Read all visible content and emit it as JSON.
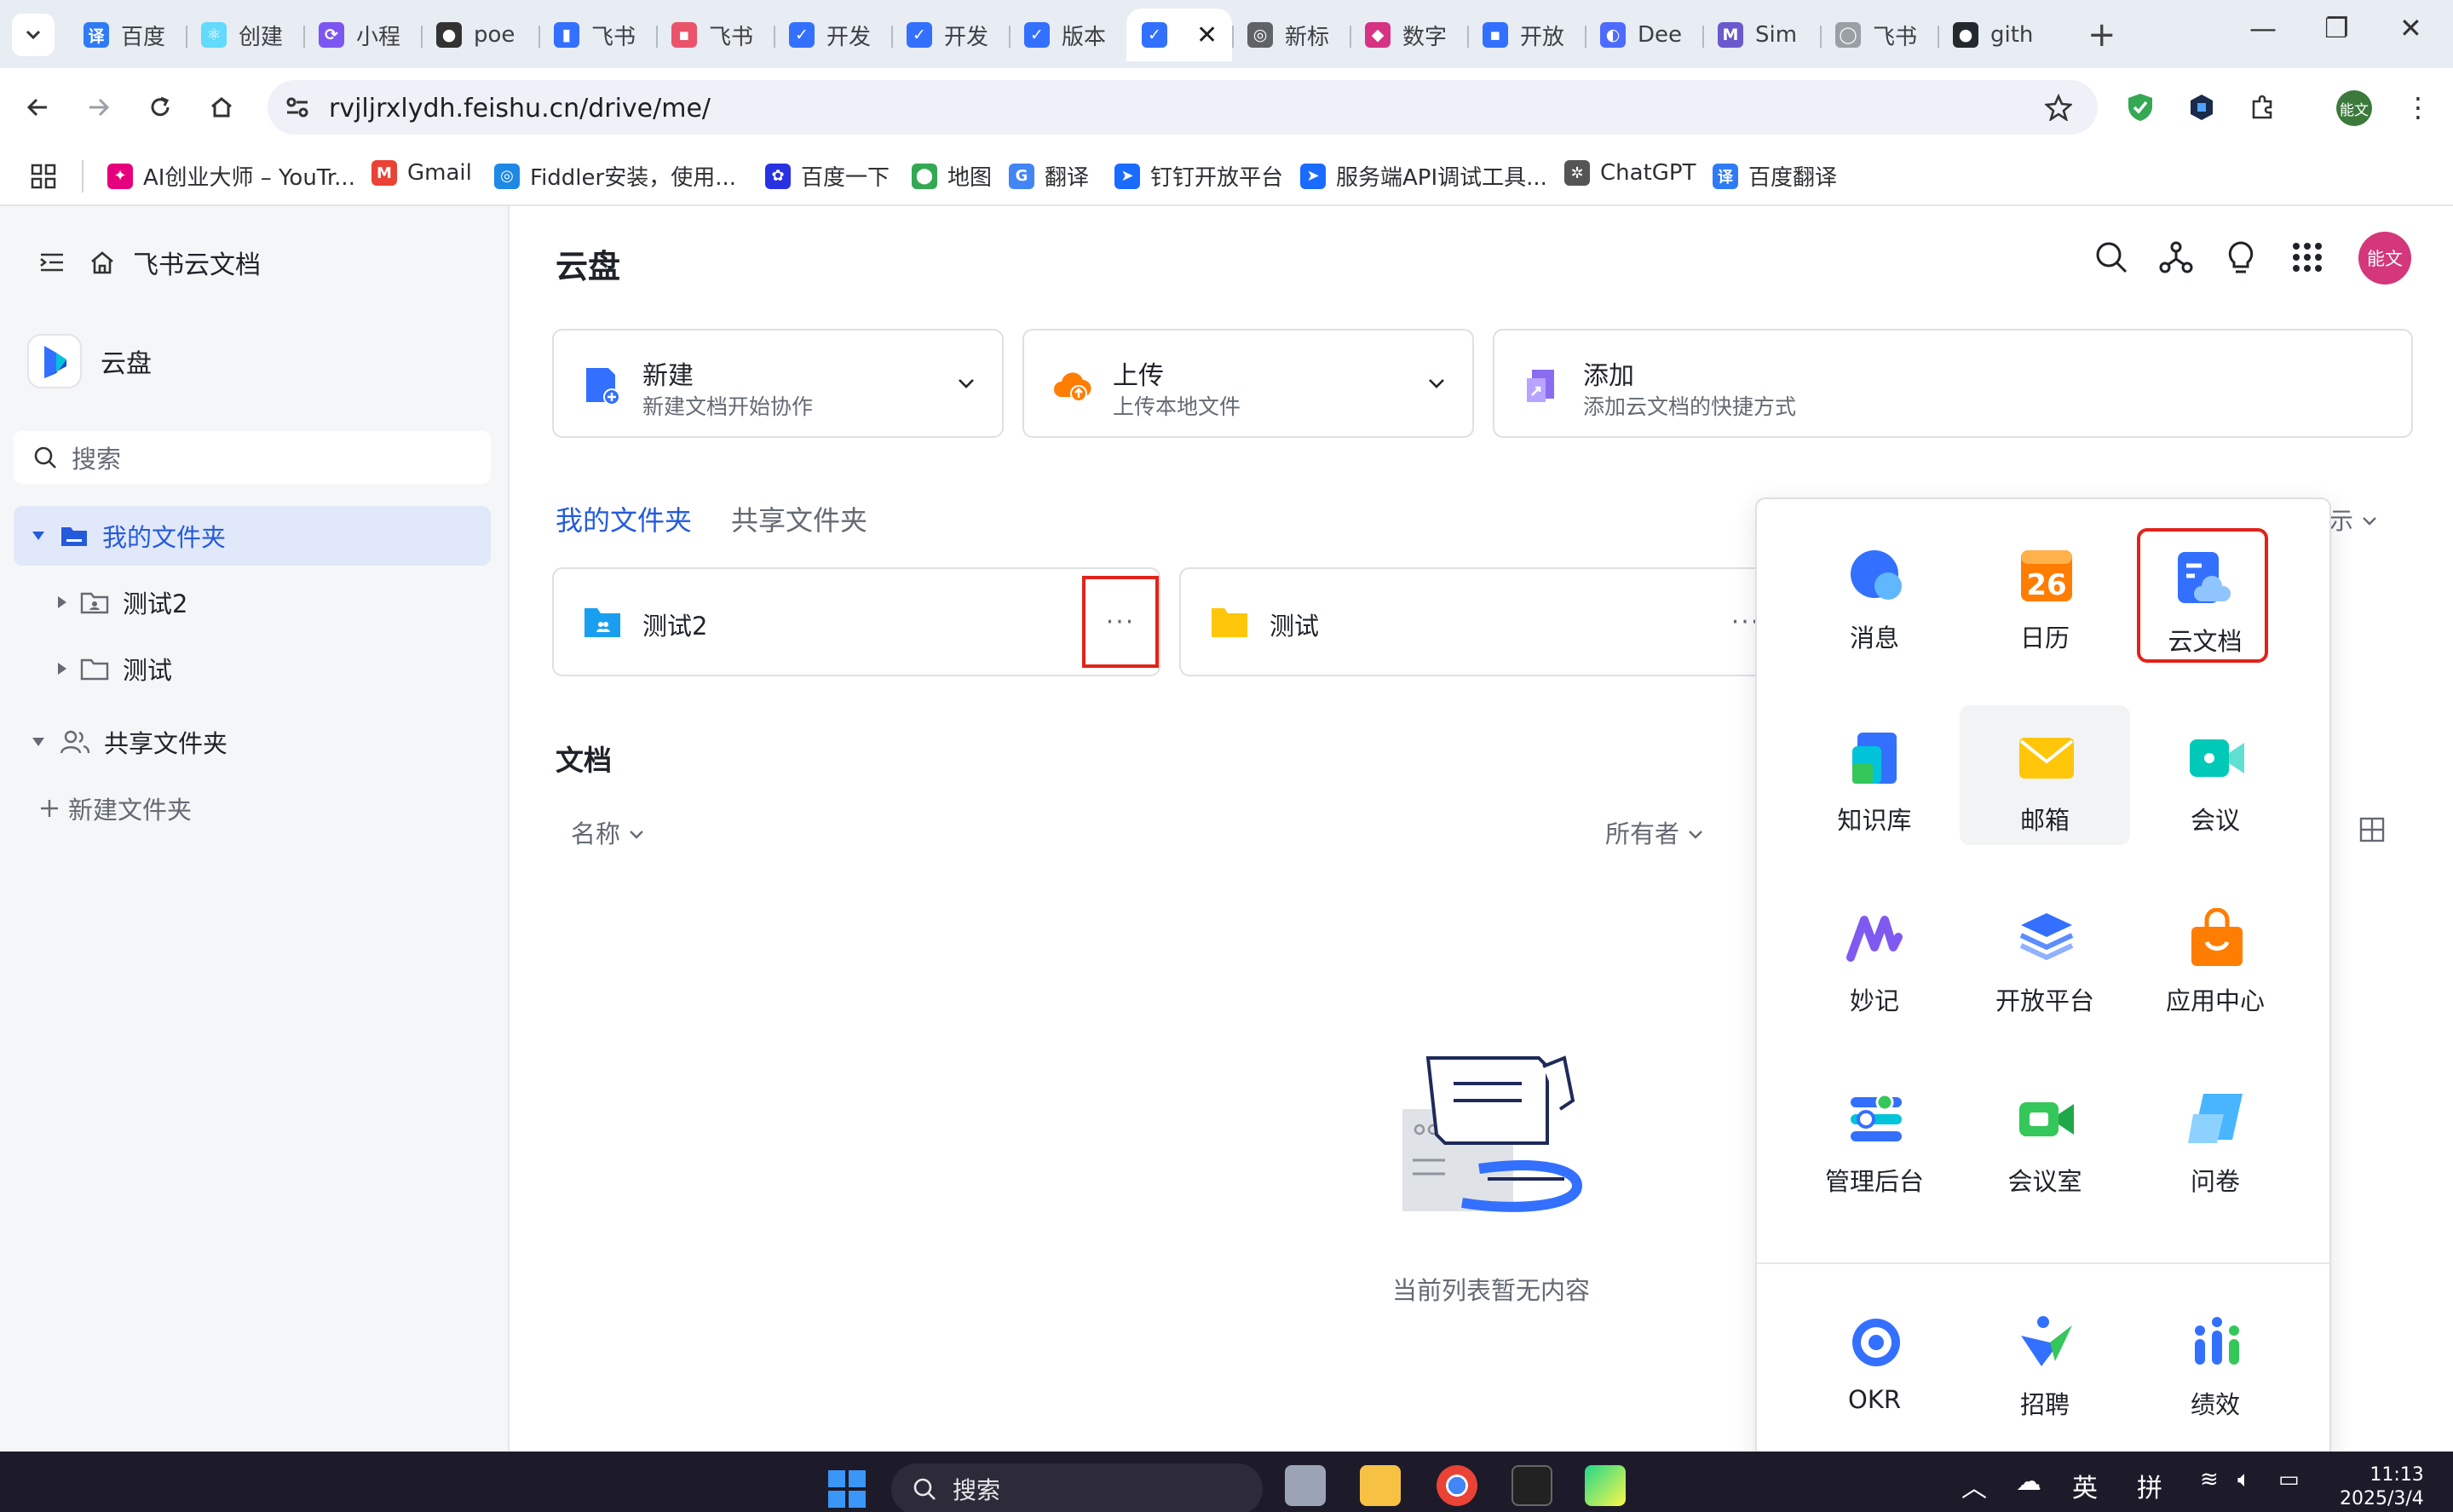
{
  "browser": {
    "tabs": [
      {
        "label": "百度",
        "color": "#2f7bf6",
        "glyph": "译"
      },
      {
        "label": "创建",
        "color": "#61dafb",
        "glyph": "⚛"
      },
      {
        "label": "小程",
        "color": "#7d56f2",
        "glyph": "⟳"
      },
      {
        "label": "poe",
        "color": "#333333",
        "glyph": "●"
      },
      {
        "label": "飞书",
        "color": "#3370ff",
        "glyph": "▮"
      },
      {
        "label": "飞书",
        "color": "#e9546b",
        "glyph": "▪"
      },
      {
        "label": "开发",
        "color": "#3370ff",
        "glyph": "✓"
      },
      {
        "label": "开发",
        "color": "#3370ff",
        "glyph": "✓"
      },
      {
        "label": "版本",
        "color": "#3370ff",
        "glyph": "✓"
      },
      {
        "label": "",
        "color": "#3370ff",
        "glyph": "✓",
        "active": true
      },
      {
        "label": "新标",
        "color": "#5f6368",
        "glyph": "◎"
      },
      {
        "label": "数字",
        "color": "#d63384",
        "glyph": "◆"
      },
      {
        "label": "开放",
        "color": "#3370ff",
        "glyph": "▪"
      },
      {
        "label": "Dee",
        "color": "#4d6bfe",
        "glyph": "◐"
      },
      {
        "label": "Sim",
        "color": "#6a5acd",
        "glyph": "M"
      },
      {
        "label": "飞书",
        "color": "#9aa0a6",
        "glyph": "◯"
      },
      {
        "label": "gith",
        "color": "#24292f",
        "glyph": "●"
      }
    ],
    "url": "rvjljrxlydh.feishu.cn/drive/me/",
    "bookmarks": [
      {
        "label": "AI创业大师 – YouTr...",
        "color": "#e6007e",
        "glyph": "✦"
      },
      {
        "label": "Gmail",
        "color": "#ea4335",
        "glyph": "M"
      },
      {
        "label": "Fiddler安装，使用...",
        "color": "#1e88e5",
        "glyph": "◎"
      },
      {
        "label": "百度一下",
        "color": "#2932e1",
        "glyph": "✿"
      },
      {
        "label": "地图",
        "color": "#34a853",
        "glyph": "⬤"
      },
      {
        "label": "翻译",
        "color": "#4285f4",
        "glyph": "G"
      },
      {
        "label": "钉钉开放平台",
        "color": "#1a6bff",
        "glyph": "➤"
      },
      {
        "label": "服务端API调试工具...",
        "color": "#1a6bff",
        "glyph": "➤"
      },
      {
        "label": "ChatGPT",
        "color": "#555555",
        "glyph": "✲"
      },
      {
        "label": "百度翻译",
        "color": "#2f7bf6",
        "glyph": "译"
      }
    ],
    "profile_initials": "能文"
  },
  "sidebar": {
    "header": "飞书云文档",
    "brand": "云盘",
    "search_placeholder": "搜索",
    "tree": {
      "my_folder": "我的文件夹",
      "child_1": "测试2",
      "child_2": "测试",
      "shared_folder": "共享文件夹",
      "new_folder": "新建文件夹"
    }
  },
  "main": {
    "title": "云盘",
    "avatar": "能文",
    "actions": [
      {
        "title": "新建",
        "subtitle": "新建文档开始协作"
      },
      {
        "title": "上传",
        "subtitle": "上传本地文件"
      },
      {
        "title": "添加",
        "subtitle": "添加云文档的快捷方式"
      }
    ],
    "folder_tabs": [
      "我的文件夹",
      "共享文件夹"
    ],
    "view_toggle": "示",
    "folders": [
      {
        "name": "测试2",
        "more": "···"
      },
      {
        "name": "测试",
        "more": "···"
      }
    ],
    "docs_title": "文档",
    "columns": {
      "name": "名称",
      "owner": "所有者"
    },
    "empty_text": "当前列表暂无内容"
  },
  "apps_panel": {
    "apps": [
      {
        "label": "消息",
        "icon": "message-icon"
      },
      {
        "label": "日历",
        "icon": "calendar-icon",
        "day": "26"
      },
      {
        "label": "云文档",
        "icon": "cloud-docs-icon"
      },
      {
        "label": "知识库",
        "icon": "wiki-icon"
      },
      {
        "label": "邮箱",
        "icon": "mail-icon"
      },
      {
        "label": "会议",
        "icon": "meeting-icon"
      },
      {
        "label": "妙记",
        "icon": "minutes-icon"
      },
      {
        "label": "开放平台",
        "icon": "open-platform-icon"
      },
      {
        "label": "应用中心",
        "icon": "app-center-icon"
      },
      {
        "label": "管理后台",
        "icon": "admin-icon"
      },
      {
        "label": "会议室",
        "icon": "meeting-room-icon"
      },
      {
        "label": "问卷",
        "icon": "survey-icon"
      },
      {
        "label": "OKR",
        "icon": "okr-icon"
      },
      {
        "label": "招聘",
        "icon": "hire-icon"
      },
      {
        "label": "绩效",
        "icon": "performance-icon"
      }
    ]
  },
  "taskbar": {
    "search": "搜索",
    "ime_lang": "英",
    "ime_mode": "拼",
    "time": "11:13",
    "date": "2025/3/4"
  },
  "colors": {
    "accent": "#245bdb",
    "highlight_box": "#e2231a",
    "avatar": "#d4377a"
  }
}
